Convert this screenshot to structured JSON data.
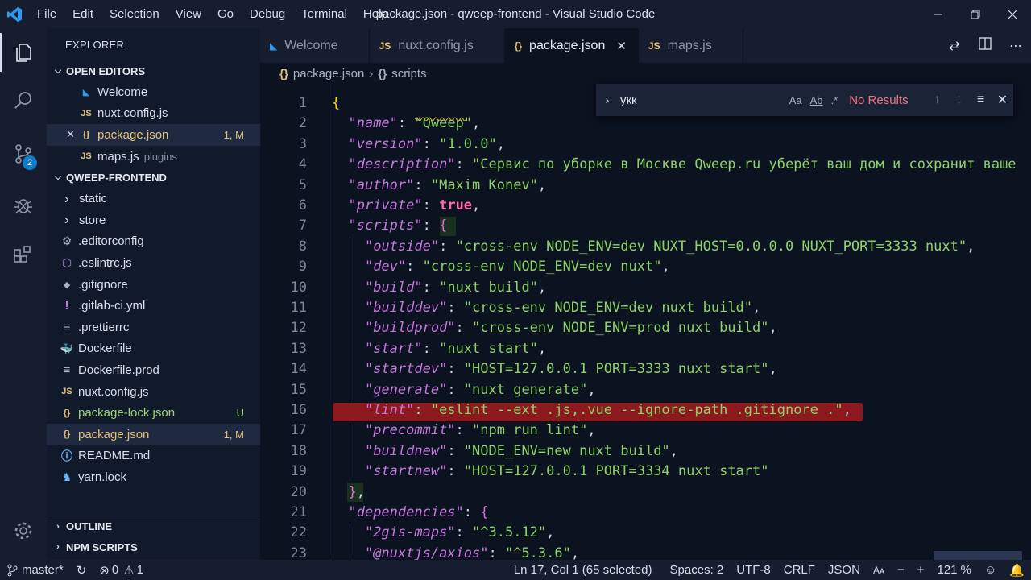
{
  "titlebar": {
    "menu": [
      "File",
      "Edit",
      "Selection",
      "View",
      "Go",
      "Debug",
      "Terminal",
      "Help"
    ],
    "title": "package.json - qweep-frontend - Visual Studio Code"
  },
  "activity": {
    "scm_badge": "2"
  },
  "sidebar": {
    "title": "EXPLORER",
    "open_editors_label": "OPEN EDITORS",
    "open_editors": [
      {
        "label": "Welcome",
        "icon": "vscode-icon"
      },
      {
        "label": "nuxt.config.js",
        "icon": "JS"
      },
      {
        "label": "package.json",
        "icon": "{}",
        "status": "1, M"
      },
      {
        "label": "maps.js",
        "icon": "JS",
        "desc": "plugins"
      }
    ],
    "project_label": "QWEEP-FRONTEND",
    "files": [
      {
        "label": "static",
        "type": "folder"
      },
      {
        "label": "store",
        "type": "folder"
      },
      {
        "label": ".editorconfig",
        "icon": "gear"
      },
      {
        "label": ".eslintrc.js",
        "icon": "eslint"
      },
      {
        "label": ".gitignore",
        "icon": "git"
      },
      {
        "label": ".gitlab-ci.yml",
        "icon": "!"
      },
      {
        "label": ".prettierrc",
        "icon": "≡"
      },
      {
        "label": "Dockerfile",
        "icon": "docker"
      },
      {
        "label": "Dockerfile.prod",
        "icon": "≡"
      },
      {
        "label": "nuxt.config.js",
        "icon": "JS"
      },
      {
        "label": "package-lock.json",
        "icon": "{}",
        "status": "U"
      },
      {
        "label": "package.json",
        "icon": "{}",
        "status": "1, M"
      },
      {
        "label": "README.md",
        "icon": "info"
      },
      {
        "label": "yarn.lock",
        "icon": "yarn"
      }
    ],
    "outline_label": "OUTLINE",
    "npm_label": "NPM SCRIPTS"
  },
  "tabs": [
    {
      "label": "Welcome",
      "icon": "vscode-icon"
    },
    {
      "label": "nuxt.config.js",
      "icon": "JS"
    },
    {
      "label": "package.json",
      "icon": "{}",
      "active": true
    },
    {
      "label": "maps.js",
      "icon": "JS"
    }
  ],
  "breadcrumb": [
    "package.json",
    "scripts"
  ],
  "find": {
    "query": "укк",
    "opt_case": "Aa",
    "opt_word": "Ab",
    "opt_regex": ".*",
    "result": "No Results"
  },
  "editor": {
    "line_numbers": [
      "1",
      "2",
      "3",
      "4",
      "5",
      "6",
      "7",
      "8",
      "9",
      "10",
      "11",
      "12",
      "13",
      "14",
      "15",
      "16",
      "17",
      "18",
      "19",
      "20",
      "21",
      "22",
      "23"
    ],
    "lines": [
      [
        {
          "t": "{",
          "c": "b"
        }
      ],
      [
        {
          "t": "  "
        },
        {
          "t": "\"name\"",
          "c": "k"
        },
        {
          "t": ": "
        },
        {
          "t": "\"Qweep\"",
          "c": "s"
        },
        {
          "t": ","
        }
      ],
      [
        {
          "t": "  "
        },
        {
          "t": "\"version\"",
          "c": "k"
        },
        {
          "t": ": "
        },
        {
          "t": "\"1.0.0\"",
          "c": "s"
        },
        {
          "t": ","
        }
      ],
      [
        {
          "t": "  "
        },
        {
          "t": "\"description\"",
          "c": "k"
        },
        {
          "t": ": "
        },
        {
          "t": "\"Сервис по уборке в Москве Qweep.ru уберёт ваш дом и сохранит ваше",
          "c": "s"
        }
      ],
      [
        {
          "t": "  "
        },
        {
          "t": "\"author\"",
          "c": "k"
        },
        {
          "t": ": "
        },
        {
          "t": "\"Maxim Konev\"",
          "c": "s"
        },
        {
          "t": ","
        }
      ],
      [
        {
          "t": "  "
        },
        {
          "t": "\"private\"",
          "c": "k"
        },
        {
          "t": ": "
        },
        {
          "t": "true",
          "c": "kw"
        },
        {
          "t": ","
        }
      ],
      [
        {
          "t": "  "
        },
        {
          "t": "\"scripts\"",
          "c": "k"
        },
        {
          "t": ": "
        },
        {
          "t": "{",
          "c": "b2"
        }
      ],
      [
        {
          "t": "    "
        },
        {
          "t": "\"outside\"",
          "c": "k"
        },
        {
          "t": ": "
        },
        {
          "t": "\"cross-env NODE_ENV=dev NUXT_HOST=0.0.0.0 NUXT_PORT=3333 nuxt\"",
          "c": "s"
        },
        {
          "t": ","
        }
      ],
      [
        {
          "t": "    "
        },
        {
          "t": "\"dev\"",
          "c": "k"
        },
        {
          "t": ": "
        },
        {
          "t": "\"cross-env NODE_ENV=dev nuxt\"",
          "c": "s"
        },
        {
          "t": ","
        }
      ],
      [
        {
          "t": "    "
        },
        {
          "t": "\"build\"",
          "c": "k"
        },
        {
          "t": ": "
        },
        {
          "t": "\"nuxt build\"",
          "c": "s"
        },
        {
          "t": ","
        }
      ],
      [
        {
          "t": "    "
        },
        {
          "t": "\"builddev\"",
          "c": "k"
        },
        {
          "t": ": "
        },
        {
          "t": "\"cross-env NODE_ENV=dev nuxt build\"",
          "c": "s"
        },
        {
          "t": ","
        }
      ],
      [
        {
          "t": "    "
        },
        {
          "t": "\"buildprod\"",
          "c": "k"
        },
        {
          "t": ": "
        },
        {
          "t": "\"cross-env NODE_ENV=prod nuxt build\"",
          "c": "s"
        },
        {
          "t": ","
        }
      ],
      [
        {
          "t": "    "
        },
        {
          "t": "\"start\"",
          "c": "k"
        },
        {
          "t": ": "
        },
        {
          "t": "\"nuxt start\"",
          "c": "s"
        },
        {
          "t": ","
        }
      ],
      [
        {
          "t": "    "
        },
        {
          "t": "\"startdev\"",
          "c": "k"
        },
        {
          "t": ": "
        },
        {
          "t": "\"HOST=127.0.0.1 PORT=3333 nuxt start\"",
          "c": "s"
        },
        {
          "t": ","
        }
      ],
      [
        {
          "t": "    "
        },
        {
          "t": "\"generate\"",
          "c": "k"
        },
        {
          "t": ": "
        },
        {
          "t": "\"nuxt generate\"",
          "c": "s"
        },
        {
          "t": ","
        }
      ],
      [
        {
          "t": "    "
        },
        {
          "t": "\"lint\"",
          "c": "k"
        },
        {
          "t": ": "
        },
        {
          "t": "\"eslint --ext .js,.vue --ignore-path .gitignore .\"",
          "c": "s"
        },
        {
          "t": ","
        }
      ],
      [
        {
          "t": "    "
        },
        {
          "t": "\"precommit\"",
          "c": "k"
        },
        {
          "t": ": "
        },
        {
          "t": "\"npm run lint\"",
          "c": "s"
        },
        {
          "t": ","
        }
      ],
      [
        {
          "t": "    "
        },
        {
          "t": "\"buildnew\"",
          "c": "k"
        },
        {
          "t": ": "
        },
        {
          "t": "\"NODE_ENV=new nuxt build\"",
          "c": "s"
        },
        {
          "t": ","
        }
      ],
      [
        {
          "t": "    "
        },
        {
          "t": "\"startnew\"",
          "c": "k"
        },
        {
          "t": ": "
        },
        {
          "t": "\"HOST=127.0.0.1 PORT=3334 nuxt start\"",
          "c": "s"
        }
      ],
      [
        {
          "t": "  "
        },
        {
          "t": "}",
          "c": "b2"
        },
        {
          "t": ","
        }
      ],
      [
        {
          "t": "  "
        },
        {
          "t": "\"dependencies\"",
          "c": "k"
        },
        {
          "t": ": "
        },
        {
          "t": "{",
          "c": "b2"
        }
      ],
      [
        {
          "t": "    "
        },
        {
          "t": "\"2gis-maps\"",
          "c": "k"
        },
        {
          "t": ": "
        },
        {
          "t": "\"^3.5.12\"",
          "c": "s"
        },
        {
          "t": ","
        }
      ],
      [
        {
          "t": "    "
        },
        {
          "t": "\"@nuxtjs/axios\"",
          "c": "k"
        },
        {
          "t": ": "
        },
        {
          "t": "\"^5.3.6\"",
          "c": "s"
        },
        {
          "t": ","
        }
      ]
    ]
  },
  "statusbar": {
    "branch": "master*",
    "errors": "0",
    "warnings": "1",
    "position": "Ln 17, Col 1 (65 selected)",
    "spaces": "Spaces: 2",
    "encoding": "UTF-8",
    "eol": "CRLF",
    "language": "JSON",
    "zoom": "121 %"
  },
  "colors": {
    "editor_bg": "#0b1220",
    "sidebar_bg": "#111a2b",
    "chrome_bg": "#151d2e",
    "key": "#c678dd",
    "string": "#8fd16a",
    "selection_error": "#8b1a1e"
  }
}
